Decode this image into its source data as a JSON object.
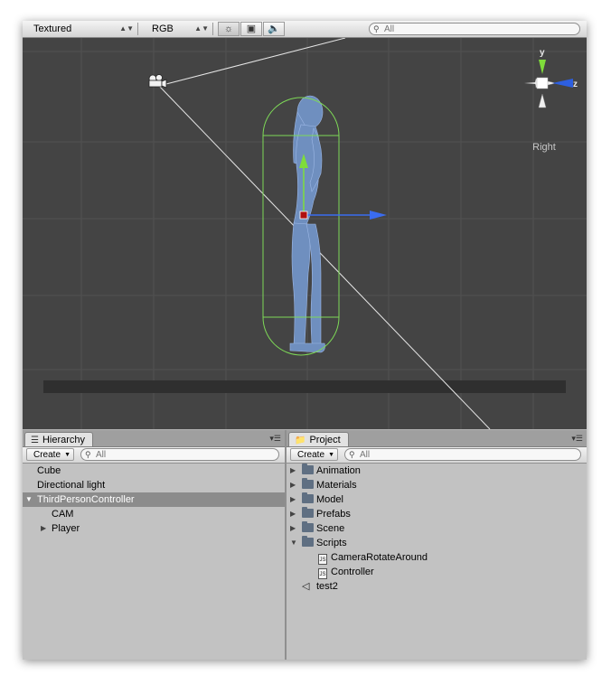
{
  "scene_toolbar": {
    "render_mode": "Textured",
    "color_mode": "RGB",
    "search_placeholder": "All",
    "buttons": [
      "lighting-toggle",
      "image-toggle",
      "audio-toggle"
    ]
  },
  "scene": {
    "orientation_label": "Right",
    "axes": {
      "y": "y",
      "z": "z"
    },
    "colors": {
      "background": "#444444",
      "collider": "#7ed957",
      "y_axis": "#7fdd3a",
      "z_axis": "#3a6cf0"
    }
  },
  "hierarchy": {
    "tab_label": "Hierarchy",
    "create_label": "Create",
    "search_placeholder": "All",
    "items": [
      {
        "label": "Cube"
      },
      {
        "label": "Directional light"
      },
      {
        "label": "ThirdPersonController"
      },
      {
        "label": "CAM"
      },
      {
        "label": "Player"
      }
    ]
  },
  "project": {
    "tab_label": "Project",
    "create_label": "Create",
    "search_placeholder": "All",
    "items": [
      {
        "label": "Animation"
      },
      {
        "label": "Materials"
      },
      {
        "label": "Model"
      },
      {
        "label": "Prefabs"
      },
      {
        "label": "Scene"
      },
      {
        "label": "Scripts"
      },
      {
        "label": "CameraRotateAround"
      },
      {
        "label": "Controller"
      },
      {
        "label": "test2"
      }
    ]
  }
}
